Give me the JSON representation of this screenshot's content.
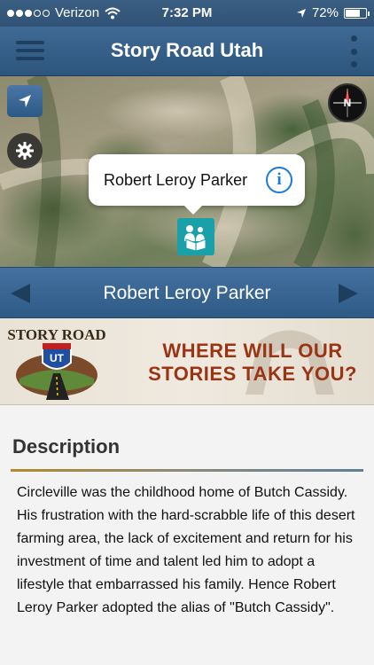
{
  "status_bar": {
    "carrier": "Verizon",
    "time": "7:32 PM",
    "battery": "72%",
    "battery_level": 0.72
  },
  "nav": {
    "title": "Story Road Utah",
    "menu_icon": "hamburger-icon",
    "more_icon": "kebab-icon"
  },
  "map": {
    "callout_title": "Robert Leroy Parker",
    "compass_label": "N",
    "pin_icon": "story-reader-icon"
  },
  "title_bar": {
    "title": "Robert Leroy Parker"
  },
  "banner": {
    "logo_top": "STORY ROAD",
    "logo_shield": "UT",
    "tagline_line1": "WHERE WILL OUR",
    "tagline_line2": "STORIES TAKE YOU?"
  },
  "description": {
    "heading": "Description",
    "body": "Circleville was the childhood home of Butch Cassidy. His frustration with the hard-scrabble life of this desert farming area, the lack of excitement and return for his investment of time and talent led him to adopt a lifestyle that embarrassed his family. Hence Robert Leroy Parker adopted the alias of \"Butch Cassidy\"."
  },
  "colors": {
    "nav_blue": "#2d557c",
    "pin_teal": "#1aa0a8",
    "info_blue": "#1a7ad9",
    "tagline_red": "#9a3414"
  }
}
